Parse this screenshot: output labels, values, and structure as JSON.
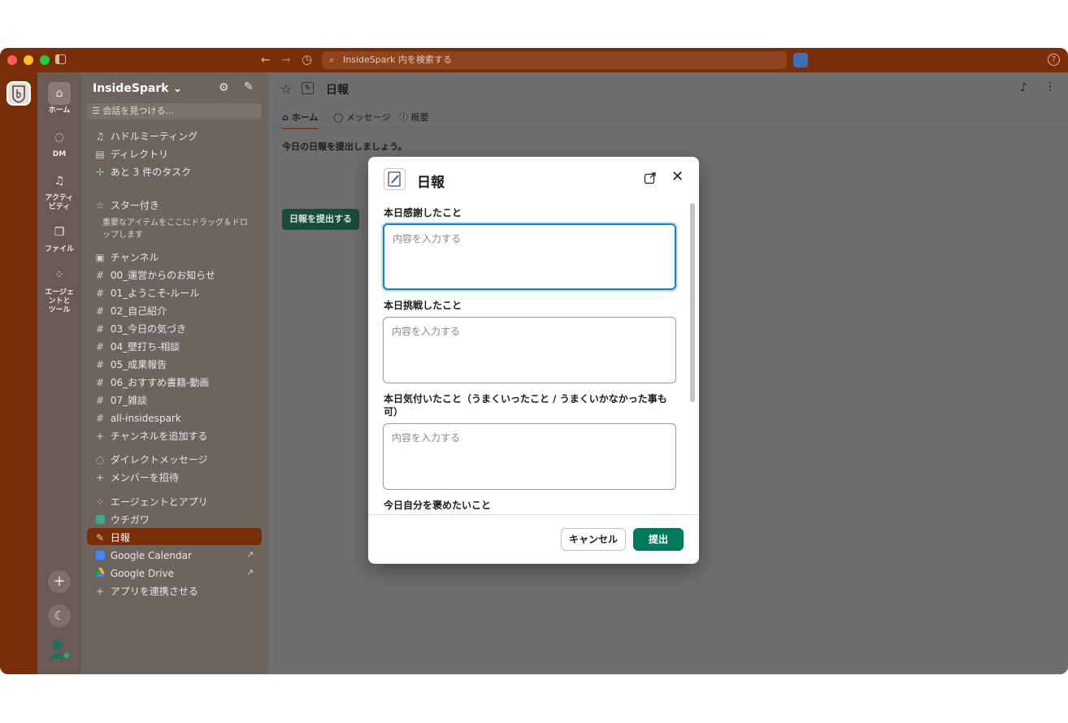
{
  "titlebar": {
    "search_placeholder": "InsideSpark 内を検索する",
    "back_icon": "←",
    "forward_icon": "→",
    "history_icon": "◷",
    "help_icon": "?"
  },
  "rail": {
    "items": [
      {
        "label": "ホーム",
        "icon": "home-icon"
      },
      {
        "label": "DM",
        "icon": "dm-icon"
      },
      {
        "label": "アクティビティ",
        "line1": "アクティ",
        "line2": "ビティ",
        "icon": "bell-icon"
      },
      {
        "label": "ファイル",
        "icon": "file-icon"
      },
      {
        "label": "エージェントとツール",
        "line1": "エージェ",
        "line2": "ントと",
        "line3": "ツール",
        "icon": "apps-icon"
      }
    ],
    "add_icon": "+",
    "theme_icon": "☾"
  },
  "sidebar": {
    "workspace": "InsideSpark",
    "chevron": "⌄",
    "search_placeholder": "会話を見つける...",
    "huddle": "ハドルミーティング",
    "directory": "ディレクトリ",
    "tasks": "あと 3 件のタスク",
    "starred_header": "スター付き",
    "starred_hint_1": "重要なアイテムをここにドラッグ＆ドロ",
    "starred_hint_2": "ップします",
    "channels_header": "チャンネル",
    "channels": [
      "00_運営からのお知らせ",
      "01_ようこそ-ルール",
      "02_自己紹介",
      "03_今日の気づき",
      "04_壁打ち-相談",
      "05_成果報告",
      "06_おすすめ書籍-動画",
      "07_雑談",
      "all-insidespark"
    ],
    "add_channel": "チャンネルを追加する",
    "dm_header": "ダイレクトメッセージ",
    "invite": "メンバーを招待",
    "apps_header": "エージェントとアプリ",
    "apps": [
      "ウチガワ",
      "日報",
      "Google Calendar",
      "Google Drive"
    ],
    "connect_apps": "アプリを連携させる"
  },
  "main": {
    "title": "日報",
    "tabs": [
      "ホーム",
      "メッセージ",
      "概要"
    ],
    "prompt_text": "今日の日報を提出しましょう。",
    "submit_report_button": "日報を提出する"
  },
  "modal": {
    "title": "日報",
    "fields": [
      {
        "label": "本日感謝したこと",
        "placeholder": "内容を入力する"
      },
      {
        "label": "本日挑戦したこと",
        "placeholder": "内容を入力する"
      },
      {
        "label_line1": "本日気付いたこと（うまくいったこと / うまくいかなかった事も",
        "label_line2": "可）",
        "placeholder": "内容を入力する"
      },
      {
        "label": "今日自分を褒めたいこと"
      }
    ],
    "cancel_label": "キャンセル",
    "submit_label": "提出"
  },
  "colors": {
    "titlebar": "#7a2e08",
    "selected_item": "#7a2e08",
    "submit_green": "#007a5a",
    "focus_blue": "#1d7fc9"
  }
}
